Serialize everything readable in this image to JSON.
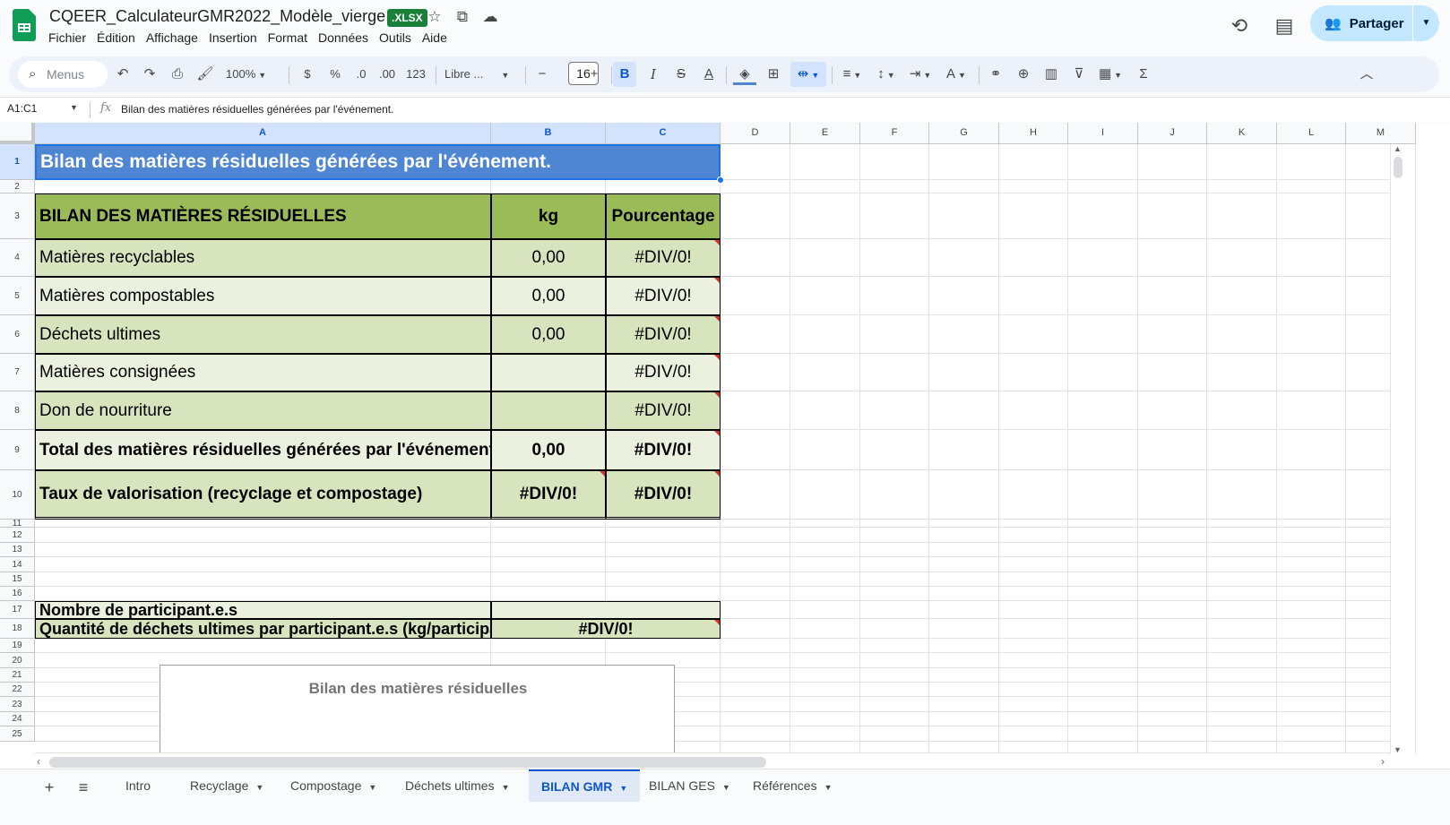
{
  "app": {
    "doc_title": "CQEER_CalculateurGMR2022_Modèle_vierge",
    "format_badge": ".XLSX",
    "share_label": "Partager",
    "menu": [
      "Fichier",
      "Édition",
      "Affichage",
      "Insertion",
      "Format",
      "Données",
      "Outils",
      "Aide"
    ]
  },
  "toolbar": {
    "search_placeholder": "Menus",
    "zoom": "100%",
    "currency": "$",
    "percent": "%",
    "dec_decrease": ".0",
    "dec_increase": ".00",
    "number_format": "123",
    "font": "Libre ...",
    "font_size": "16",
    "bold": "B",
    "italic": "I",
    "strike": "S",
    "text_color": "A"
  },
  "formula_bar": {
    "name_box": "A1:C1",
    "fx": "fx",
    "content": "Bilan des matières résiduelles générées par l'événement."
  },
  "columns": [
    "A",
    "B",
    "C",
    "D",
    "E",
    "F",
    "G",
    "H",
    "I",
    "J",
    "K",
    "L",
    "M"
  ],
  "rows": [
    "1",
    "2",
    "3",
    "4",
    "5",
    "6",
    "7",
    "8",
    "9",
    "10",
    "11",
    "12",
    "13",
    "14",
    "15",
    "16",
    "17",
    "18",
    "19",
    "20",
    "21",
    "22",
    "23",
    "24",
    "25"
  ],
  "sheet": {
    "title": "Bilan des matières résiduelles générées par l'événement.",
    "table_header": [
      "BILAN DES MATIÈRES RÉSIDUELLES",
      "kg",
      "Pourcentage"
    ],
    "table_rows": [
      [
        "Matières recyclables",
        "0,00",
        "#DIV/0!"
      ],
      [
        "Matières compostables",
        "0,00",
        "#DIV/0!"
      ],
      [
        "Déchets ultimes",
        "0,00",
        "#DIV/0!"
      ],
      [
        "Matières consignées",
        "",
        "#DIV/0!"
      ],
      [
        "Don de nourriture",
        "",
        "#DIV/0!"
      ],
      [
        "Total des matières résiduelles générées par l'événement",
        "0,00",
        "#DIV/0!"
      ],
      [
        "Taux de valorisation (recyclage et compostage)",
        "#DIV/0!",
        "#DIV/0!"
      ]
    ],
    "participants_label": "Nombre de participant.e.s",
    "participants_value": "",
    "per_participant_label": "Quantité de déchets ultimes par participant.e.s (kg/participant.e.s)",
    "per_participant_value": "#DIV/0!",
    "chart_title": "Bilan des matières résiduelles"
  },
  "tabs": [
    {
      "label": "Intro",
      "active": false
    },
    {
      "label": "Recyclage",
      "active": false
    },
    {
      "label": "Compostage",
      "active": false
    },
    {
      "label": "Déchets ultimes",
      "active": false
    },
    {
      "label": "BILAN GMR",
      "active": true
    },
    {
      "label": "BILAN GES",
      "active": false
    },
    {
      "label": "Références",
      "active": false
    }
  ],
  "colors": {
    "title_fill": "#4f86d4",
    "header_fill": "#9bbb59",
    "row_fill_dark": "#d7e4bd",
    "row_fill_light": "#ebf1de",
    "accent": "#0b57d0"
  }
}
